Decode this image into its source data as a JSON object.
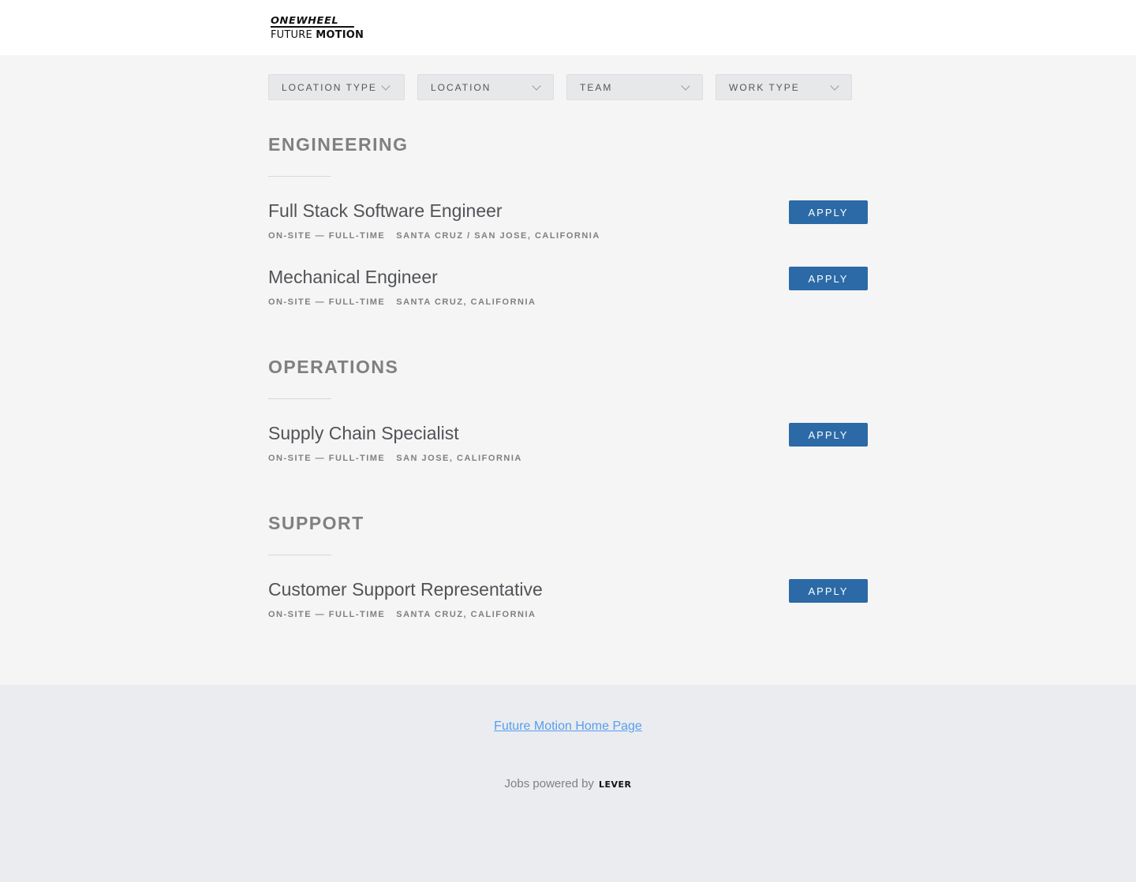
{
  "brand": {
    "top": "ONEWHEEL",
    "bottom_regular": "FUTURE ",
    "bottom_bold": "MOTION"
  },
  "filters": [
    {
      "label": "LOCATION TYPE"
    },
    {
      "label": "LOCATION"
    },
    {
      "label": "TEAM"
    },
    {
      "label": "WORK TYPE"
    }
  ],
  "groups": [
    {
      "title": "ENGINEERING",
      "postings": [
        {
          "title": "Full Stack Software Engineer",
          "commitment": "ON-SITE — FULL-TIME",
          "location": "SANTA CRUZ / SAN JOSE, CALIFORNIA",
          "apply": "APPLY"
        },
        {
          "title": "Mechanical Engineer",
          "commitment": "ON-SITE — FULL-TIME",
          "location": "SANTA CRUZ, CALIFORNIA",
          "apply": "APPLY"
        }
      ]
    },
    {
      "title": "OPERATIONS",
      "postings": [
        {
          "title": "Supply Chain Specialist",
          "commitment": "ON-SITE — FULL-TIME",
          "location": "SAN JOSE, CALIFORNIA",
          "apply": "APPLY"
        }
      ]
    },
    {
      "title": "SUPPORT",
      "postings": [
        {
          "title": "Customer Support Representative",
          "commitment": "ON-SITE — FULL-TIME",
          "location": "SANTA CRUZ, CALIFORNIA",
          "apply": "APPLY"
        }
      ]
    }
  ],
  "footer": {
    "home_link": "Future Motion Home Page",
    "powered_by": "Jobs powered by",
    "lever": "LEVER"
  },
  "colors": {
    "accent": "#2b6aa6",
    "link": "#579eee",
    "background": "#f5f5f5"
  }
}
